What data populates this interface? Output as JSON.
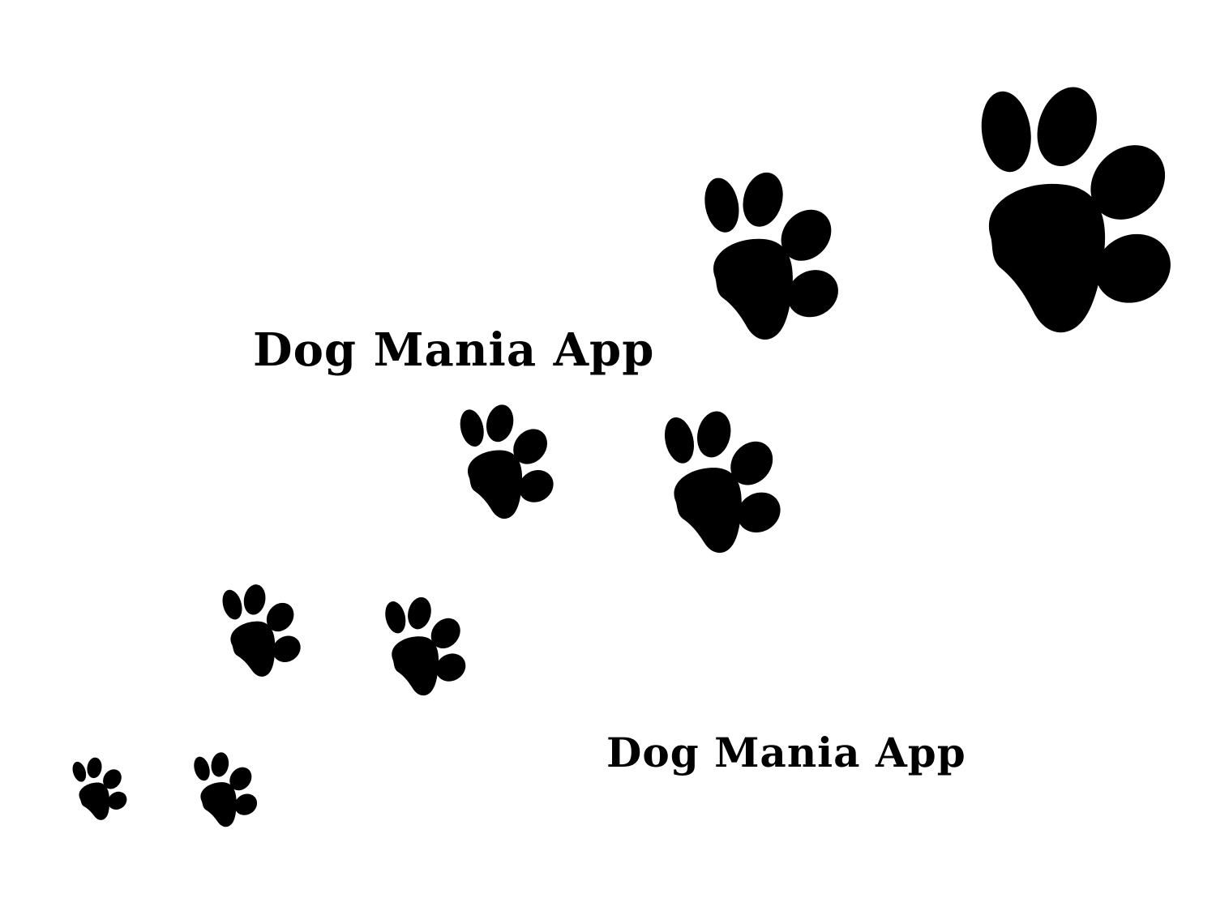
{
  "captions": {
    "top": "Dog Mania App",
    "bottom": "Dog Mania App"
  },
  "paw_icon_name": "paw-print-icon",
  "colors": {
    "background": "#ffffff",
    "ink": "#000000"
  }
}
